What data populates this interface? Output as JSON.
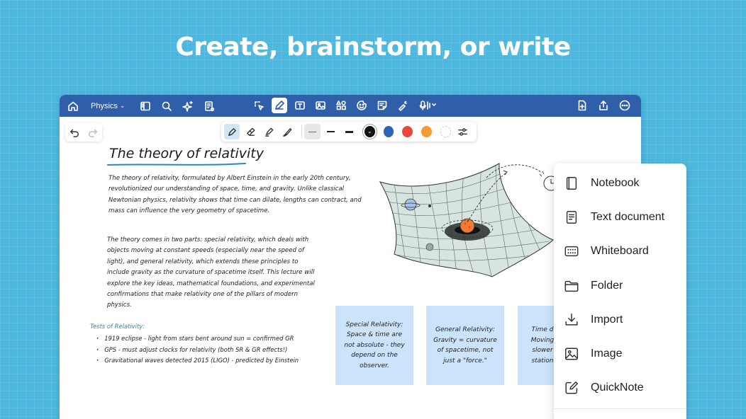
{
  "headline": "Create, brainstorm, or write",
  "toolbar": {
    "notebook_name": "Physics"
  },
  "pen_palette": {
    "colors": [
      "#111111",
      "#2f63b5",
      "#e8473e",
      "#f49b33"
    ],
    "selected_color": "#111111"
  },
  "note": {
    "title": "The theory of relativity",
    "paragraph1": "The theory of relativity, formulated by Albert Einstein in the early 20th century, revolutionized our understanding of space, time, and gravity. Unlike classical Newtonian physics, relativity shows that time can dilate, lengths can contract, and mass can influence the very geometry of spacetime.",
    "paragraph2": "The theory comes in two parts: special relativity, which deals with objects moving at constant speeds (especially near the speed of light), and general relativity, which extends these principles to include gravity as the curvature of spacetime itself. This lecture will explore the key ideas, mathematical foundations, and experimental confirmations that make relativity one of the pillars of modern physics.",
    "tests_heading": "Tests of Relativity:",
    "tests": [
      "1919 eclipse - light from stars bent around sun = confirmed GR",
      "GPS - must adjust clocks for relativity (both SR & GR effects!)",
      "Gravitational waves detected 2015 (LIGO) - predicted by Einstein"
    ]
  },
  "stickies": [
    "Special Relativity: Space & time are not absolute - they depend on the observer.",
    "General Relativity: Gravity = curvature of spacetime, not just a \"force.\"",
    "Time d Moving slower station"
  ],
  "menu": {
    "items": [
      {
        "label": "Notebook",
        "icon": "notebook-icon"
      },
      {
        "label": "Text document",
        "icon": "text-document-icon"
      },
      {
        "label": "Whiteboard",
        "icon": "whiteboard-icon"
      },
      {
        "label": "Folder",
        "icon": "folder-icon"
      },
      {
        "label": "Import",
        "icon": "import-icon"
      },
      {
        "label": "Image",
        "icon": "image-icon"
      },
      {
        "label": "QuickNote",
        "icon": "quicknote-icon"
      }
    ]
  }
}
